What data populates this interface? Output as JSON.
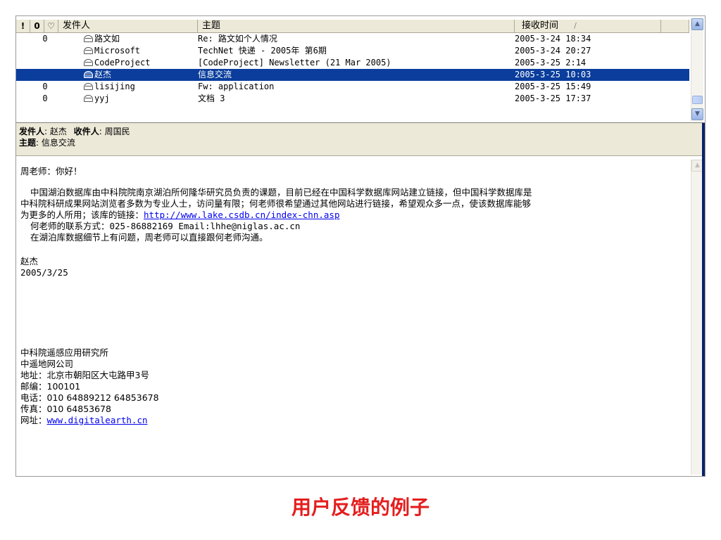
{
  "list": {
    "headers": {
      "flag": "!",
      "attach": "0",
      "watch": "♡",
      "from": "发件人",
      "subject": "主题",
      "received": "接收时间",
      "sort": "/"
    },
    "rows": [
      {
        "attach": "0",
        "from": "路文如",
        "subject": "Re: 路文如个人情况",
        "date": "2005-3-24 18:34",
        "selected": false
      },
      {
        "attach": "",
        "from": "Microsoft",
        "subject": "TechNet 快递 - 2005年 第6期",
        "date": "2005-3-24 20:27",
        "selected": false
      },
      {
        "attach": "",
        "from": "CodeProject",
        "subject": "[CodeProject] Newsletter (21 Mar 2005)",
        "date": "2005-3-25 2:14",
        "selected": false
      },
      {
        "attach": "",
        "from": "赵杰",
        "subject": "信息交流",
        "date": "2005-3-25 10:03",
        "selected": true
      },
      {
        "attach": "0",
        "from": "lisijing",
        "subject": "Fw: application",
        "date": "2005-3-25 15:49",
        "selected": false
      },
      {
        "attach": "0",
        "from": "yyj",
        "subject": "文档 3",
        "date": "2005-3-25 17:37",
        "selected": false
      }
    ]
  },
  "preview": {
    "from_label": "发件人",
    "from_value": "赵杰",
    "to_label": "收件人",
    "to_value": "周国民",
    "subject_label": "主题",
    "subject_value": "信息交流",
    "sep": ":"
  },
  "body": {
    "greeting": "周老师：你好！",
    "para1_line1": "中国湖泊数据库由中科院院南京湖泊所何隆华研究员负责的课题，目前已经在中国科学数据库网站建立链接，但中国科学数据库是",
    "para1_line2": "中科院科研成果网站浏览者多数为专业人士，访问量有限；何老师很希望通过其他网站进行链接，希望观众多一点，使该数据库能够",
    "para1_line3_prefix": "为更多的人所用；该库的链接：",
    "para1_link": "http://www.lake.csdb.cn/index-chn.asp",
    "contact_line": "何老师的联系方式：025-86882169  Email:lhhe@niglas.ac.cn",
    "note_line": "在湖泊库数据细节上有问题，周老师可以直接跟何老师沟通。",
    "sign_name": "赵杰",
    "sign_date": "2005/3/25",
    "org1": "中科院遥感应用研究所",
    "org2": "中遥地网公司",
    "address": "地址：北京市朝阳区大屯路甲3号",
    "postcode": "邮编：100101",
    "phone": "电话：010 64889212 64853678",
    "fax": "传真：010 64853678",
    "web_prefix": "网址：",
    "web_link": "www.digitalearth.cn"
  },
  "caption": "用户反馈的例子",
  "colors": {
    "selection": "#0a3d9c",
    "caption": "#e41e1e",
    "link": "#0000ee",
    "panel": "#ece9d8"
  }
}
